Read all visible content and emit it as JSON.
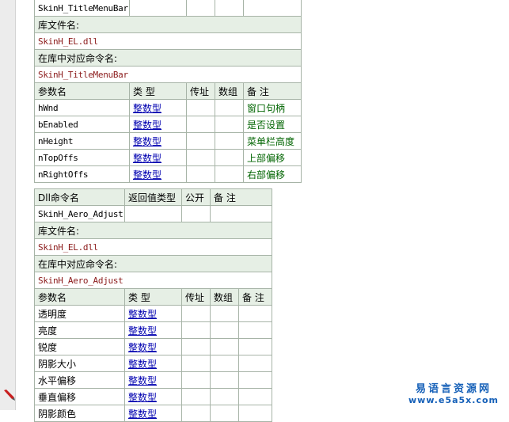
{
  "table1": {
    "top_row_name": "SkinH_TitleMenuBar",
    "lib_label": "库文件名:",
    "lib_value": "SkinH_EL.dll",
    "cmd_label": "在库中对应命令名:",
    "cmd_value": "SkinH_TitleMenuBar",
    "param_headers": [
      "参数名",
      "类 型",
      "传址",
      "数组",
      "备 注"
    ],
    "params": [
      {
        "name": "hWnd",
        "type": "整数型",
        "byref": "",
        "array": "",
        "note": "窗口句柄"
      },
      {
        "name": "bEnabled",
        "type": "整数型",
        "byref": "",
        "array": "",
        "note": "是否设置"
      },
      {
        "name": "nHeight",
        "type": "整数型",
        "byref": "",
        "array": "",
        "note": "菜单栏高度"
      },
      {
        "name": "nTopOffs",
        "type": "整数型",
        "byref": "",
        "array": "",
        "note": "上部偏移"
      },
      {
        "name": "nRightOffs",
        "type": "整数型",
        "byref": "",
        "array": "",
        "note": "右部偏移"
      }
    ]
  },
  "table2": {
    "headers": [
      "Dll命令名",
      "返回值类型",
      "公开",
      "备 注"
    ],
    "row_name": "SkinH_Aero_Adjust",
    "lib_label": "库文件名:",
    "lib_value": "SkinH_EL.dll",
    "cmd_label": "在库中对应命令名:",
    "cmd_value": "SkinH_Aero_Adjust",
    "param_headers": [
      "参数名",
      "类 型",
      "传址",
      "数组",
      "备 注"
    ],
    "params": [
      {
        "name": "透明度",
        "type": "整数型",
        "byref": "",
        "array": "",
        "note": ""
      },
      {
        "name": "亮度",
        "type": "整数型",
        "byref": "",
        "array": "",
        "note": ""
      },
      {
        "name": "锐度",
        "type": "整数型",
        "byref": "",
        "array": "",
        "note": ""
      },
      {
        "name": "阴影大小",
        "type": "整数型",
        "byref": "",
        "array": "",
        "note": ""
      },
      {
        "name": "水平偏移",
        "type": "整数型",
        "byref": "",
        "array": "",
        "note": ""
      },
      {
        "name": "垂直偏移",
        "type": "整数型",
        "byref": "",
        "array": "",
        "note": ""
      },
      {
        "name": "阴影颜色",
        "type": "整数型",
        "byref": "",
        "array": "",
        "note": ""
      }
    ]
  },
  "watermark": {
    "line1": "易语言资源网",
    "line2": "www.e5a5x.com"
  },
  "colors": {
    "header_bg": "#e6efe5",
    "border": "#a7b4a7",
    "lib_text": "#8b1a1a",
    "type_link": "#0000b0",
    "note_text": "#006400",
    "watermark": "#1560b8"
  },
  "icons": {
    "gutter_marker": "pencil-icon"
  }
}
